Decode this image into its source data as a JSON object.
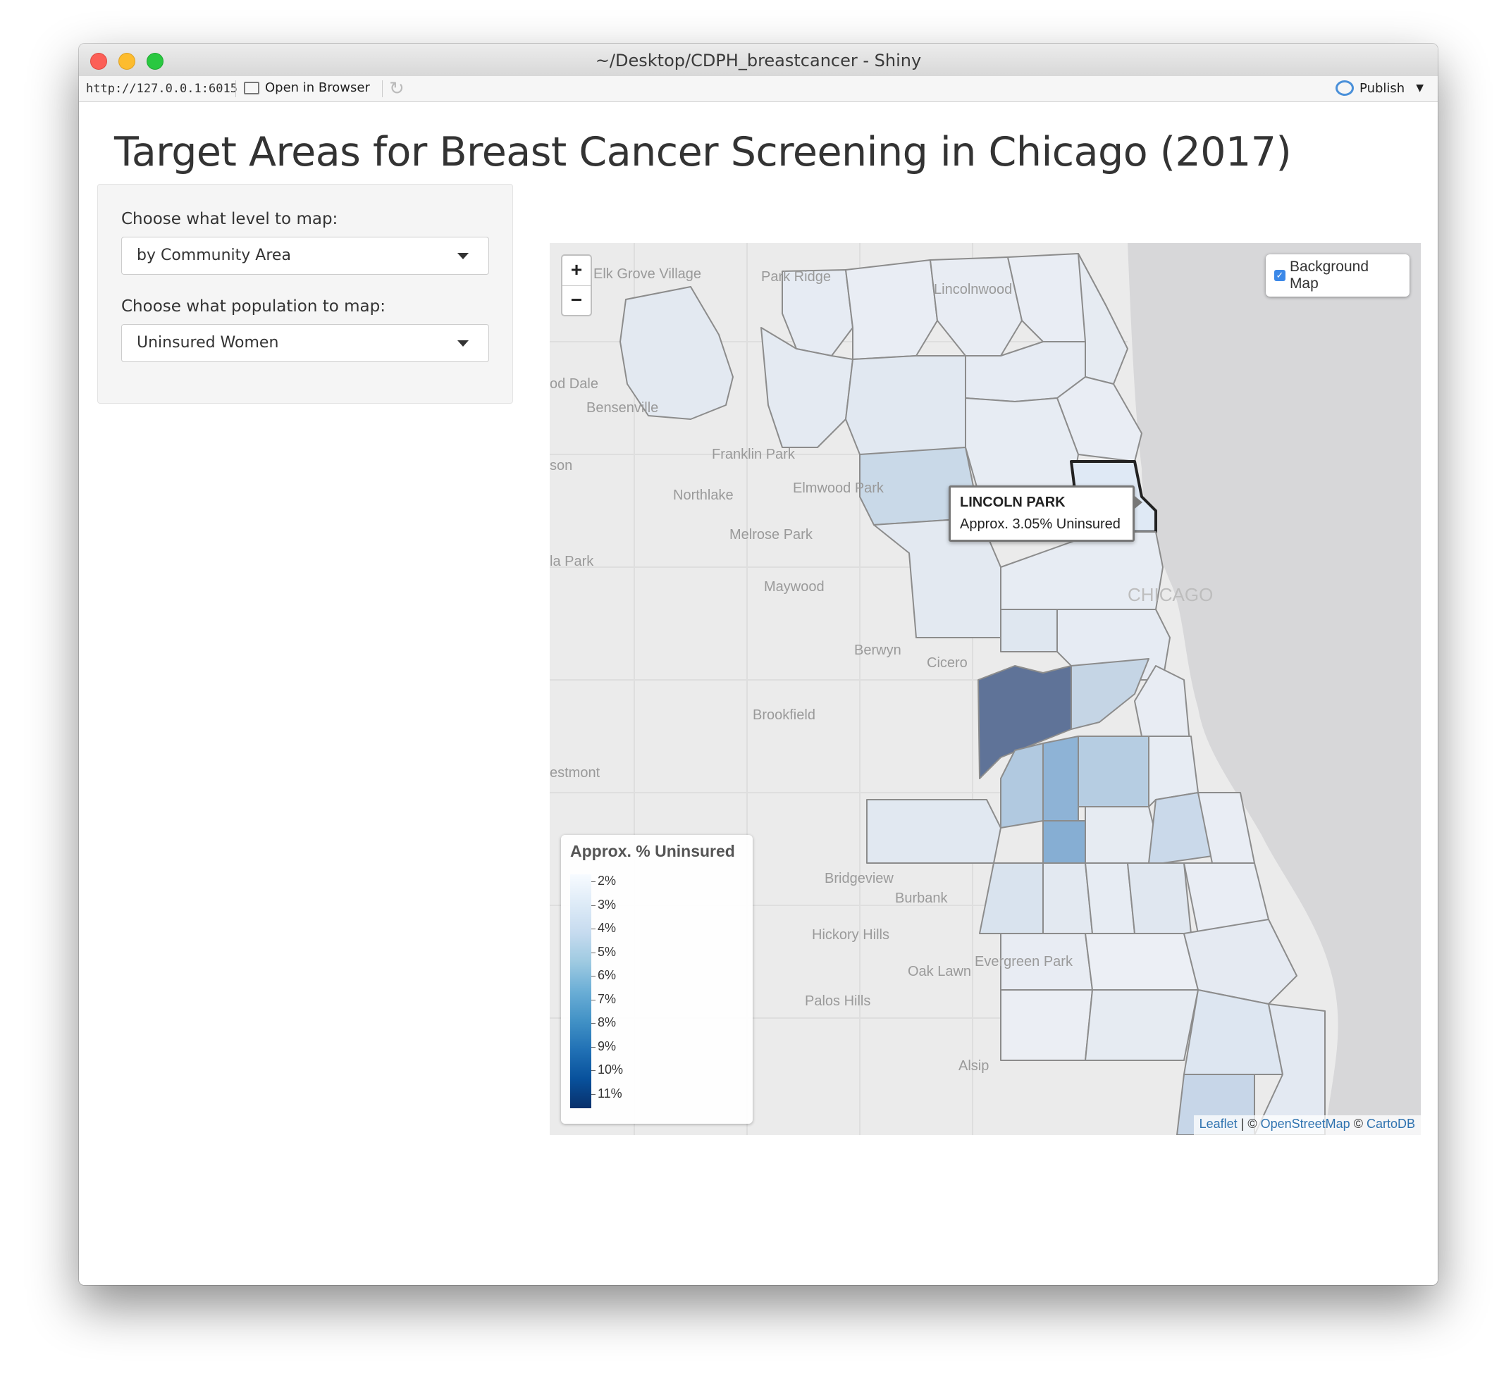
{
  "window": {
    "title": "~/Desktop/CDPH_breastcancer - Shiny"
  },
  "toolbar": {
    "url": "http://127.0.0.1:6015",
    "open_in_browser": "Open in Browser",
    "publish": "Publish"
  },
  "page": {
    "title": "Target Areas for Breast Cancer Screening in Chicago (2017)"
  },
  "controls": {
    "level_label": "Choose what level to map:",
    "level_value": "by Community Area",
    "population_label": "Choose what population to map:",
    "population_value": "Uninsured Women"
  },
  "map": {
    "zoom_in": "+",
    "zoom_out": "−",
    "layer_toggle_label": "Background Map",
    "layer_toggle_checked": true,
    "tooltip": {
      "name": "LINCOLN PARK",
      "value": "Approx. 3.05% Uninsured"
    },
    "place_labels": [
      "Elk Grove Village",
      "Park Ridge",
      "Lincolnwood",
      "od Dale",
      "Bensenville",
      "Franklin Park",
      "son",
      "Northlake",
      "Elmwood Park",
      "Melrose Park",
      "la Park",
      "Maywood",
      "CHICAGO",
      "Berwyn",
      "Cicero",
      "Brookfield",
      "estmont",
      "Bridgeview",
      "Burbank",
      "Hickory Hills",
      "Evergreen Park",
      "Oak Lawn",
      "Palos Hills",
      "Alsip"
    ],
    "attribution": {
      "leaflet": "Leaflet",
      "sep1": " | © ",
      "osm": "OpenStreetMap",
      "sep2": " © ",
      "carto": "CartoDB"
    },
    "accent_color": "#2f73b0"
  },
  "legend": {
    "title": "Approx. % Uninsured",
    "labels": [
      "2%",
      "3%",
      "4%",
      "5%",
      "6%",
      "7%",
      "8%",
      "9%",
      "10%",
      "11%"
    ],
    "colors": [
      "#f7fbff",
      "#08306b"
    ]
  }
}
